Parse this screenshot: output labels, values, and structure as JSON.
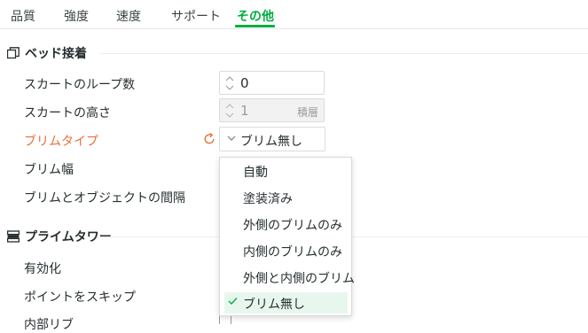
{
  "tabs": [
    {
      "label": "品質"
    },
    {
      "label": "強度"
    },
    {
      "label": "速度"
    },
    {
      "label": "サポート"
    },
    {
      "label": "その他"
    }
  ],
  "active_tab": "その他",
  "accent_color": "#00ae42",
  "modified_color": "#e5723f",
  "sections": {
    "bed_adhesion": {
      "title": "ベッド接着",
      "icon": "bed-adhesion-icon",
      "rows": {
        "skirt_loops": {
          "label": "スカートのループ数",
          "value": "0"
        },
        "skirt_height": {
          "label": "スカートの高さ",
          "value": "1",
          "unit": "積層"
        },
        "brim_type": {
          "label": "ブリムタイプ",
          "value": "ブリム無し"
        },
        "brim_width": {
          "label": "ブリム幅"
        },
        "brim_object_gap": {
          "label": "ブリムとオブジェクトの間隔"
        }
      }
    },
    "prime_tower": {
      "title": "プライムタワー",
      "icon": "prime-tower-icon",
      "rows": {
        "enable": {
          "label": "有効化"
        },
        "skip_points": {
          "label": "ポイントをスキップ"
        },
        "inner_ribs": {
          "label": "内部リブ"
        }
      }
    }
  },
  "brim_type_options": [
    {
      "label": "自動"
    },
    {
      "label": "塗装済み"
    },
    {
      "label": "外側のブリムのみ"
    },
    {
      "label": "内側のブリムのみ"
    },
    {
      "label": "外側と内側のブリム"
    },
    {
      "label": "ブリム無し",
      "selected": true
    }
  ]
}
